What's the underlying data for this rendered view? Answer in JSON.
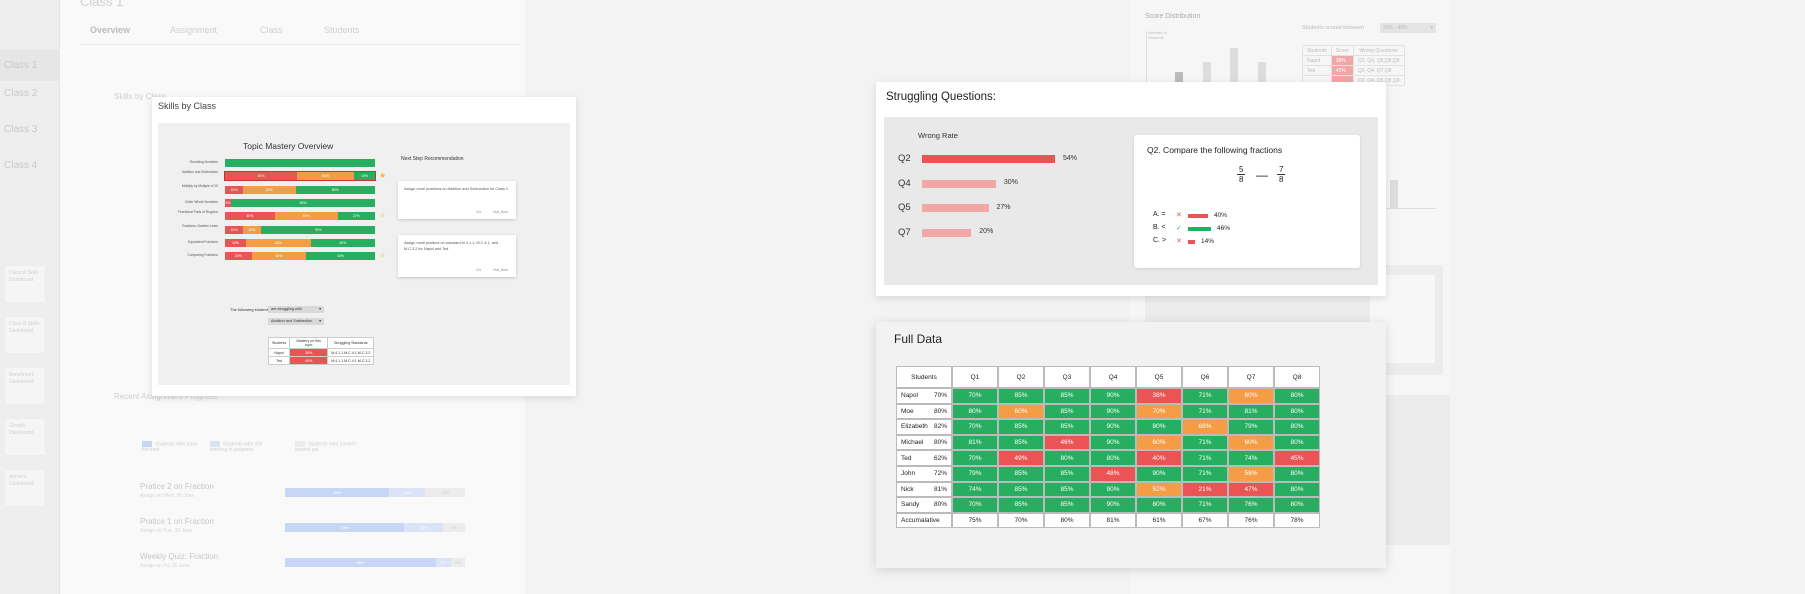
{
  "background": {
    "page_title": "Class 1",
    "tabs": [
      "Overview",
      "Assignment",
      "Class",
      "Students"
    ],
    "classes": [
      "Class 1",
      "Class 2",
      "Class 3",
      "Class 4"
    ],
    "side_items": [
      "Class A Skills Dashboard",
      "Class B Skills Dashboard",
      "Benchmark Dashboard",
      "Growth Dashboard",
      "Admin's Dashboard"
    ],
    "skills_heading": "Skills by Class",
    "recent_heading": "Recent Assignment Progress",
    "legend": [
      "Students who have finished",
      "Students who still working in progress",
      "Students who haven't started yet"
    ],
    "assignments": [
      {
        "title": "Pratice 2 on Fraction",
        "sub": "Assign on Wed, 30 June",
        "finished": 58,
        "progress": 20,
        "pct1": "58%",
        "pct2": "20%",
        "pct3": "13%"
      },
      {
        "title": "Pratice 1 on Fraction",
        "sub": "Assign on Tue, 30 June",
        "finished": 66,
        "progress": 22,
        "pct1": "75%",
        "pct2": "20%",
        "pct3": "5%"
      },
      {
        "title": "Weekly Quiz: Fraction",
        "sub": "Assign on Fri, 30 June",
        "finished": 84,
        "progress": 8,
        "pct1": "88%",
        "pct2": "5%",
        "pct3": "2%"
      }
    ],
    "score_distribution_title": "Score Distribution",
    "students_scored_between_label": "Students scored between",
    "score_range_value": "20% - 40%",
    "score_y_label": "Number of Students",
    "score_table_headers": [
      "Students",
      "Score",
      "Wrong Questions"
    ],
    "score_table_rows": [
      {
        "name": "Napol",
        "score": "38%",
        "wrong": "Q2, Q4, Q5,Q8,Q9"
      },
      {
        "name": "Ted",
        "score": "40%",
        "wrong": "Q2, Q4, Q7,Q8"
      },
      {
        "name": "",
        "score": "",
        "wrong": "Q2, Q4, Q5,Q8,Q9"
      }
    ]
  },
  "skills": {
    "card_title": "Skills by Class",
    "chart_title": "Topic Mastery Overview",
    "topics": [
      {
        "label": "Rounding Numbers",
        "segs": [
          {
            "w": 100,
            "c": "g",
            "t": ""
          }
        ],
        "star": ""
      },
      {
        "label": "Addition and Subtraction",
        "segs": [
          {
            "w": 48,
            "c": "r",
            "t": "30%"
          },
          {
            "w": 38,
            "c": "o",
            "t": "60%"
          },
          {
            "w": 14,
            "c": "g",
            "t": "10%"
          }
        ],
        "star": "bright"
      },
      {
        "label": "Multiply by Multiple of 10",
        "segs": [
          {
            "w": 12,
            "c": "r",
            "t": "10%"
          },
          {
            "w": 35,
            "c": "o",
            "t": "20%"
          },
          {
            "w": 53,
            "c": "g",
            "t": "80%"
          }
        ],
        "star": ""
      },
      {
        "label": "Order Whole Numbers",
        "segs": [
          {
            "w": 4,
            "c": "r",
            "t": "3%"
          },
          {
            "w": 96,
            "c": "g",
            "t": "95%"
          }
        ],
        "star": ""
      },
      {
        "label": "Fractional Parts of Regions",
        "segs": [
          {
            "w": 33,
            "c": "r",
            "t": "30%"
          },
          {
            "w": 42,
            "c": "o",
            "t": "40%"
          },
          {
            "w": 25,
            "c": "g",
            "t": "27%"
          }
        ],
        "star": "dim"
      },
      {
        "label": "Fractions: Number Lines",
        "segs": [
          {
            "w": 12,
            "c": "r",
            "t": "10%"
          },
          {
            "w": 12,
            "c": "o",
            "t": "10%"
          },
          {
            "w": 76,
            "c": "g",
            "t": "75%"
          }
        ],
        "star": ""
      },
      {
        "label": "Equivalent Fractions",
        "segs": [
          {
            "w": 14,
            "c": "r",
            "t": "10%"
          },
          {
            "w": 43,
            "c": "o",
            "t": "45%"
          },
          {
            "w": 43,
            "c": "g",
            "t": "45%"
          }
        ],
        "star": ""
      },
      {
        "label": "Comparing Fractions",
        "segs": [
          {
            "w": 18,
            "c": "r",
            "t": "20%"
          },
          {
            "w": 36,
            "c": "o",
            "t": "40%"
          },
          {
            "w": 46,
            "c": "g",
            "t": "40%"
          }
        ],
        "star": "dim"
      }
    ],
    "next_step_title": "Next Step Recommendation",
    "recommendations": [
      {
        "text": "Assign more practices on Addition and Subtraction for Class 1.",
        "go": "Go",
        "not_now": "Not_Now"
      },
      {
        "text": "Assign more pratices on standard M.4.1.1, M.C.4.1, and M.C.3.2 for Napol and Ted.",
        "go": "Go",
        "not_now": "Not_Now"
      }
    ],
    "following_label": "The following students",
    "dropdown1": "are struggling with",
    "dropdown2": "Addition and Subtraction",
    "mini_headers": [
      "Students",
      "Mastery on this topic",
      "Struggling Standards"
    ],
    "mini_rows": [
      {
        "name": "Napol",
        "mastery": "38%",
        "standards": "M.4.1.1 M.C.4.1 M.C.3.2"
      },
      {
        "name": "Ted",
        "mastery": "40%",
        "standards": "M.4.1.1 M.C.4.1 M.C.3.2"
      }
    ]
  },
  "struggle": {
    "title": "Struggling Questions:",
    "chart_title": "Wrong Rate",
    "questions": [
      {
        "q": "Q2",
        "rate": 54,
        "label": "54%",
        "color": "#ea5455"
      },
      {
        "q": "Q4",
        "rate": 30,
        "label": "30%",
        "color": "#f2a7a7"
      },
      {
        "q": "Q5",
        "rate": 27,
        "label": "27%",
        "color": "#f2a7a7"
      },
      {
        "q": "Q7",
        "rate": 20,
        "label": "20%",
        "color": "#f2a7a7"
      }
    ],
    "detail_title": "Q2. Compare the following fractions",
    "frac1_num": "5",
    "frac1_den": "8",
    "frac2_num": "7",
    "frac2_den": "8",
    "operator": "—",
    "options": [
      {
        "label": "A. =",
        "mark": "✕",
        "mark_color": "#ea5455",
        "pct": 40,
        "pct_label": "40%",
        "bar_color": "#ea5455"
      },
      {
        "label": "B. <",
        "mark": "✓",
        "mark_color": "#27ae60",
        "pct": 46,
        "pct_label": "46%",
        "bar_color": "#27ae60"
      },
      {
        "label": "C. >",
        "mark": "✕",
        "mark_color": "#ea5455",
        "pct": 14,
        "pct_label": "14%",
        "bar_color": "#ea5455"
      }
    ]
  },
  "full": {
    "title": "Full Data",
    "header_students": "Students",
    "questions": [
      "Q1",
      "Q2",
      "Q3",
      "Q4",
      "Q5",
      "Q6",
      "Q7",
      "Q8"
    ],
    "rows": [
      {
        "name": "Napol",
        "avg": "70%",
        "cells": [
          [
            "70%",
            "g"
          ],
          [
            "85%",
            "g"
          ],
          [
            "85%",
            "g"
          ],
          [
            "90%",
            "g"
          ],
          [
            "38%",
            "r"
          ],
          [
            "71%",
            "g"
          ],
          [
            "60%",
            "o"
          ],
          [
            "80%",
            "g"
          ]
        ]
      },
      {
        "name": "Moe",
        "avg": "80%",
        "cells": [
          [
            "80%",
            "g"
          ],
          [
            "60%",
            "o"
          ],
          [
            "85%",
            "g"
          ],
          [
            "90%",
            "g"
          ],
          [
            "70%",
            "o"
          ],
          [
            "71%",
            "g"
          ],
          [
            "81%",
            "g"
          ],
          [
            "80%",
            "g"
          ]
        ]
      },
      {
        "name": "Elizabeth",
        "avg": "82%",
        "cells": [
          [
            "70%",
            "g"
          ],
          [
            "85%",
            "g"
          ],
          [
            "85%",
            "g"
          ],
          [
            "90%",
            "g"
          ],
          [
            "80%",
            "g"
          ],
          [
            "68%",
            "o"
          ],
          [
            "79%",
            "g"
          ],
          [
            "80%",
            "g"
          ]
        ]
      },
      {
        "name": "Michael",
        "avg": "80%",
        "cells": [
          [
            "81%",
            "g"
          ],
          [
            "85%",
            "g"
          ],
          [
            "46%",
            "r"
          ],
          [
            "90%",
            "g"
          ],
          [
            "60%",
            "o"
          ],
          [
            "71%",
            "g"
          ],
          [
            "60%",
            "o"
          ],
          [
            "80%",
            "g"
          ]
        ]
      },
      {
        "name": "Ted",
        "avg": "62%",
        "cells": [
          [
            "70%",
            "g"
          ],
          [
            "49%",
            "r"
          ],
          [
            "80%",
            "g"
          ],
          [
            "80%",
            "g"
          ],
          [
            "40%",
            "r"
          ],
          [
            "71%",
            "g"
          ],
          [
            "74%",
            "g"
          ],
          [
            "45%",
            "r"
          ]
        ]
      },
      {
        "name": "John",
        "avg": "72%",
        "cells": [
          [
            "79%",
            "g"
          ],
          [
            "85%",
            "g"
          ],
          [
            "85%",
            "g"
          ],
          [
            "48%",
            "r"
          ],
          [
            "90%",
            "g"
          ],
          [
            "71%",
            "g"
          ],
          [
            "58%",
            "o"
          ],
          [
            "80%",
            "g"
          ]
        ]
      },
      {
        "name": "Nick",
        "avg": "81%",
        "cells": [
          [
            "74%",
            "g"
          ],
          [
            "85%",
            "g"
          ],
          [
            "85%",
            "g"
          ],
          [
            "90%",
            "g"
          ],
          [
            "52%",
            "o"
          ],
          [
            "21%",
            "r"
          ],
          [
            "47%",
            "r"
          ],
          [
            "80%",
            "g"
          ]
        ]
      },
      {
        "name": "Sandy",
        "avg": "80%",
        "cells": [
          [
            "70%",
            "g"
          ],
          [
            "85%",
            "g"
          ],
          [
            "85%",
            "g"
          ],
          [
            "90%",
            "g"
          ],
          [
            "80%",
            "g"
          ],
          [
            "71%",
            "g"
          ],
          [
            "76%",
            "g"
          ],
          [
            "80%",
            "g"
          ]
        ]
      }
    ],
    "accumulative_label": "Accumalative",
    "accumulative": [
      "75%",
      "70%",
      "80%",
      "81%",
      "61%",
      "67%",
      "76%",
      "78%"
    ]
  },
  "colors": {
    "green": "#27ae60",
    "orange": "#f59d45",
    "red": "#ea5455",
    "light_red": "#f2a7a7"
  }
}
